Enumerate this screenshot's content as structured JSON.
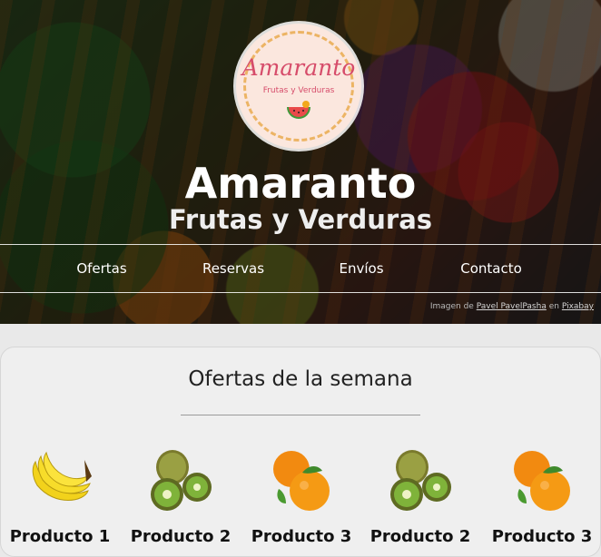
{
  "brand": {
    "logo_name": "Amaranto",
    "logo_sub": "Frutas y Verduras",
    "title": "Amaranto",
    "subtitle": "Frutas y Verduras"
  },
  "nav": {
    "items": [
      {
        "label": "Ofertas"
      },
      {
        "label": "Reservas"
      },
      {
        "label": "Envíos"
      },
      {
        "label": "Contacto"
      }
    ]
  },
  "credit": {
    "prefix": "Imagen de",
    "author": "Pavel PavelPasha",
    "middle": "en",
    "site": "Pixabay"
  },
  "offers": {
    "heading": "Ofertas de la semana",
    "products": [
      {
        "name": "Producto 1",
        "icon": "banana-icon"
      },
      {
        "name": "Producto 2",
        "icon": "kiwi-icon"
      },
      {
        "name": "Producto 3",
        "icon": "orange-icon"
      },
      {
        "name": "Producto 2",
        "icon": "kiwi-icon"
      },
      {
        "name": "Producto 3",
        "icon": "orange-icon"
      }
    ]
  },
  "colors": {
    "logo_accent": "#d64c6a",
    "logo_bg": "#fbe7de"
  }
}
